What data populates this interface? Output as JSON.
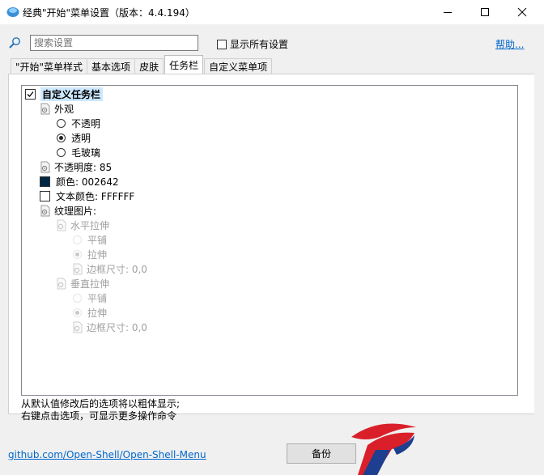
{
  "window": {
    "title": "经典\"开始\"菜单设置（版本：4.4.194）",
    "minimize_glyph": "—",
    "maximize_glyph": "☐",
    "close_glyph": "✕"
  },
  "search": {
    "placeholder": "搜索设置",
    "value": ""
  },
  "show_all": {
    "label": "显示所有设置",
    "checked": false
  },
  "help_link": "帮助...",
  "tabs": [
    {
      "label": "\"开始\"菜单样式",
      "active": false
    },
    {
      "label": "基本选项",
      "active": false
    },
    {
      "label": "皮肤",
      "active": false
    },
    {
      "label": "任务栏",
      "active": true
    },
    {
      "label": "自定义菜单项",
      "active": false
    }
  ],
  "tree": {
    "root": {
      "label": "自定义任务栏",
      "checked": true
    },
    "appearance": {
      "label": "外观",
      "options": [
        {
          "label": "不透明",
          "selected": false
        },
        {
          "label": "透明",
          "selected": true
        },
        {
          "label": "毛玻璃",
          "selected": false
        }
      ]
    },
    "opacity": "不透明度: 85",
    "color": {
      "label": "颜色: 002642",
      "value": "#002642"
    },
    "text_color": {
      "label": "文本颜色: FFFFFF",
      "value": "#FFFFFF"
    },
    "texture": {
      "label": "纹理图片:",
      "horizontal": {
        "label": "水平拉伸",
        "tile": "平铺",
        "stretch": "拉伸",
        "border": "边框尺寸: 0,0"
      },
      "vertical": {
        "label": "垂直拉伸",
        "tile": "平铺",
        "stretch": "拉伸",
        "border": "边框尺寸: 0,0"
      }
    }
  },
  "hint_lines": [
    "从默认值修改后的选项将以粗体显示;",
    "右键点击选项，可显示更多操作命令"
  ],
  "github_link": "github.com/Open-Shell/Open-Shell-Menu",
  "backup_button": "备份",
  "colors": {
    "link": "#0066cc",
    "selection": "#cce8ff",
    "taskbar_color": "#002642",
    "logo_red": "#d9202a",
    "logo_blue": "#1e3f8f"
  },
  "icons": {
    "app": "shell-icon",
    "search": "search-icon",
    "setting": "setting-page-icon"
  }
}
